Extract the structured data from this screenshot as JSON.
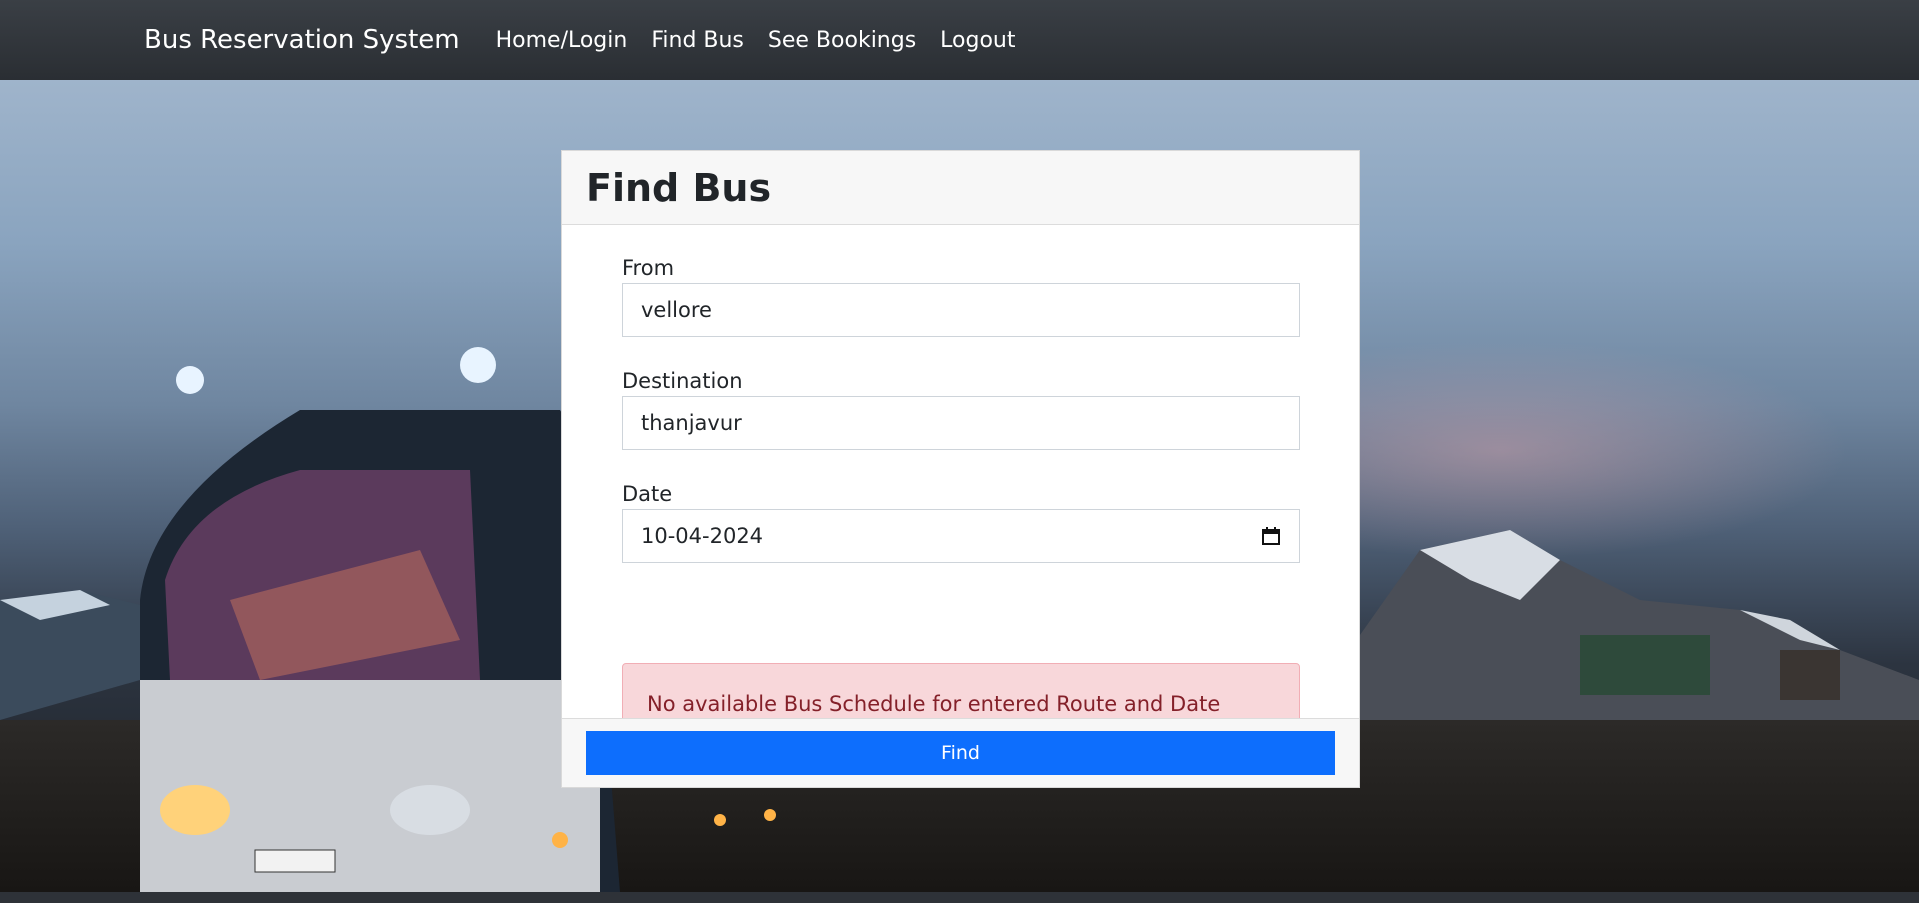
{
  "navbar": {
    "brand": "Bus Reservation System",
    "links": [
      "Home/Login",
      "Find Bus",
      "See Bookings",
      "Logout"
    ]
  },
  "card": {
    "title": "Find Bus",
    "from_label": "From",
    "from_value": "vellore",
    "destination_label": "Destination",
    "destination_value": "thanjavur",
    "date_label": "Date",
    "date_value": "10-04-2024",
    "alert": "No available Bus Schedule for entered Route and Date",
    "find_button": "Find"
  },
  "colors": {
    "navbar": "#343a40",
    "primary": "#0d6efd",
    "alert_bg": "#f8d7da",
    "alert_text": "#842029"
  }
}
